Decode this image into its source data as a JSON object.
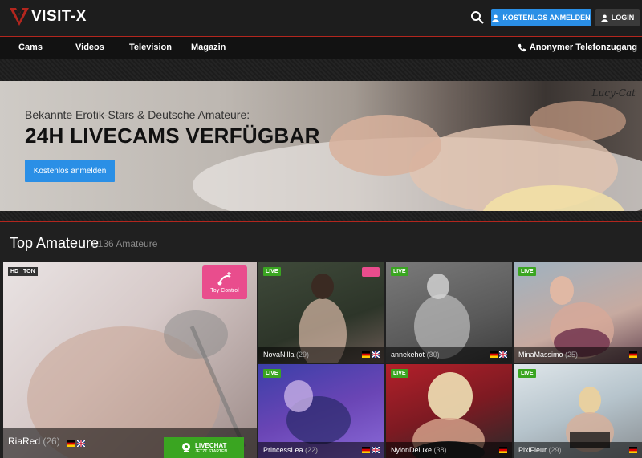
{
  "header": {
    "logo_text": "VISIT-X",
    "signup_label": "KOSTENLOS ANMELDEN",
    "login_label": "LOGIN",
    "brand_color": "#b3261e",
    "accent_color": "#2a8fe6"
  },
  "nav": {
    "items": [
      "Cams",
      "Videos",
      "Television",
      "Magazin"
    ],
    "phone_label": "Anonymer Telefonzugang"
  },
  "hero": {
    "subtitle": "Bekannte Erotik-Stars & Deutsche Amateure:",
    "title": "24H LIVECAMS VERFÜGBAR",
    "button_label": "Kostenlos anmelden",
    "signature": "Lucy-Cat"
  },
  "section": {
    "title": "Top Amateure",
    "count": "/ 136 Amateure"
  },
  "featured": {
    "badge_hd": "HD",
    "badge_ton": "TON",
    "toy_label": "Toy Control",
    "name": "RiaRed",
    "age": "(26)",
    "livechat_line1": "LIVECHAT",
    "livechat_line2": "JETZT STARTEN"
  },
  "cards": [
    {
      "name": "NovaNilla",
      "age": "(29)",
      "live": "LIVE"
    },
    {
      "name": "annekehot",
      "age": "(30)",
      "live": "LIVE"
    },
    {
      "name": "MinaMassimo",
      "age": "(25)",
      "live": "LIVE"
    },
    {
      "name": "PrincessLea",
      "age": "(22)",
      "live": "LIVE"
    },
    {
      "name": "NylonDeluxe",
      "age": "(38)",
      "live": "LIVE"
    },
    {
      "name": "PixiFleur",
      "age": "(29)",
      "live": "LIVE"
    }
  ]
}
